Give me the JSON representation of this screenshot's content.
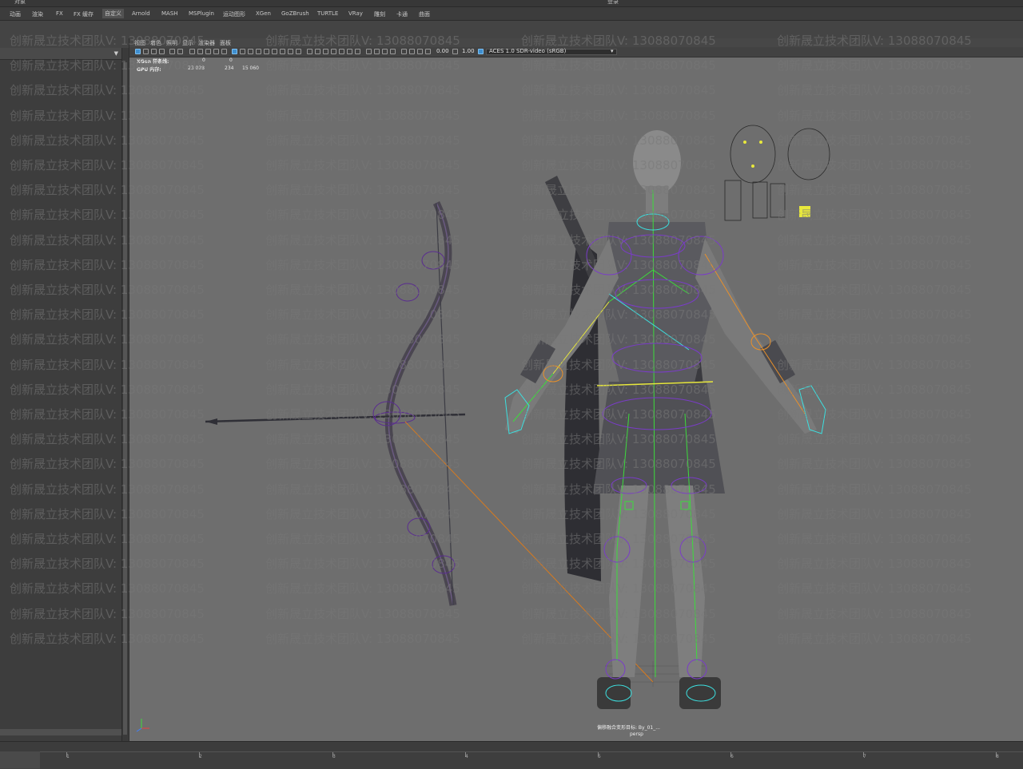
{
  "top_strip": {
    "left_text": "对象",
    "right_text": "登录"
  },
  "shelf_tabs": [
    {
      "label": "动画"
    },
    {
      "label": "渲染"
    },
    {
      "label": "FX"
    },
    {
      "label": "FX 缓存"
    },
    {
      "label": "自定义",
      "active": true
    },
    {
      "label": "Arnold"
    },
    {
      "label": "MASH"
    },
    {
      "label": "MSPlugin"
    },
    {
      "label": "运动图形"
    },
    {
      "label": "XGen"
    },
    {
      "label": "GoZBrush"
    },
    {
      "label": "TURTLE"
    },
    {
      "label": "VRay"
    },
    {
      "label": "雕刻"
    },
    {
      "label": "卡通"
    },
    {
      "label": "曲面"
    }
  ],
  "viewport": {
    "menu": [
      "视图",
      "着色",
      "照明",
      "显示",
      "渲染器",
      "面板"
    ],
    "toolbar": {
      "exposure": "0.00",
      "gamma": "1.00",
      "color_space": "ACES 1.0 SDR-video (sRGB)"
    },
    "hud": {
      "xgen_label": "XGen 样条线:",
      "xgen_values": [
        "0",
        "0"
      ],
      "gpu_label": "GPU 内存:",
      "gpu_values": [
        "23 028",
        "234",
        "15 060"
      ]
    },
    "status_label": "偏移融合变形目标: By_01_...",
    "camera": "persp"
  },
  "timeline": {
    "ticks": [
      "1",
      "2",
      "3",
      "4",
      "5",
      "6",
      "7",
      "8"
    ]
  },
  "watermark": {
    "text": "创新晟立技术团队V: 13088070845"
  },
  "colors": {
    "viewport_bg": "#6e6e6e",
    "rig_purple": "#7a3cc8",
    "rig_green": "#3cdc3c",
    "rig_orange": "#e8902a",
    "rig_cyan": "#3ce0e0",
    "rig_yellow": "#e8e83c"
  },
  "icons": [
    "grid-icon",
    "camera-icon",
    "select-icon",
    "wireframe-icon",
    "shaded-icon",
    "light-icon",
    "isolate-icon",
    "axis-icon"
  ]
}
